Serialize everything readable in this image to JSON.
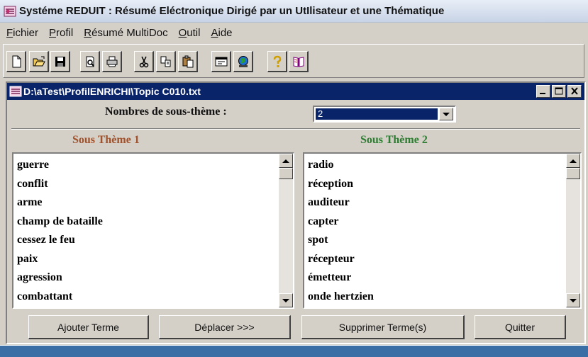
{
  "app": {
    "title": "Systéme REDUIT : Résumé Eléctronique Dirigé par un UtIlisateur et une Thématique"
  },
  "menu": {
    "items": [
      {
        "first": "F",
        "rest": "ichier"
      },
      {
        "first": "P",
        "rest": "rofil"
      },
      {
        "first": "R",
        "rest": "ésumé MultiDoc"
      },
      {
        "first": "O",
        "rest": "util"
      },
      {
        "first": "A",
        "rest": "ide"
      }
    ]
  },
  "toolbar": {
    "icons": [
      "new-document-icon",
      "open-folder-icon",
      "save-icon",
      "print-preview-icon",
      "print-icon",
      "cut-icon",
      "copy-icon",
      "paste-icon",
      "window-icon",
      "globe-icon",
      "help-icon",
      "book-icon"
    ]
  },
  "inner_window": {
    "title": "D:\\aTest\\ProfilENRICHI\\Topic C010.txt"
  },
  "form": {
    "count_label": "Nombres de sous-thème :",
    "count_value": "2"
  },
  "themes": {
    "left": {
      "header": "Sous Thème 1",
      "color": "#a0522d",
      "items": [
        "guerre",
        "conflit",
        "arme",
        "champ de bataille",
        "cessez le feu",
        "paix",
        "agression",
        "combattant"
      ]
    },
    "right": {
      "header": "Sous Thème 2",
      "color": "#2e7d32",
      "items": [
        "radio",
        "réception",
        "auditeur",
        "capter",
        "spot",
        "récepteur",
        "émetteur",
        "onde hertzien"
      ]
    }
  },
  "buttons": {
    "add": "Ajouter Terme",
    "move": "Déplacer >>>",
    "delete": "Supprimer Terme(s)",
    "quit": "Quitter"
  },
  "colors": {
    "titlebar_active": "#0a246a",
    "selection": "#0a246a",
    "taskbar": "#3a6ea5"
  }
}
